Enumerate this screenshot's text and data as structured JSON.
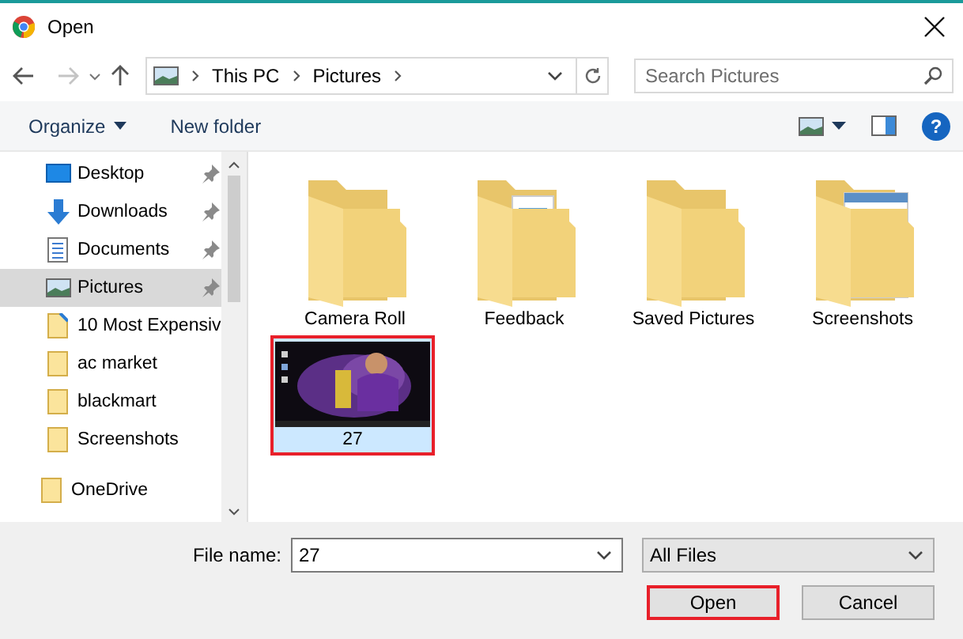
{
  "window": {
    "title": "Open"
  },
  "nav": {
    "breadcrumbs": [
      "This PC",
      "Pictures"
    ],
    "search": {
      "placeholder": "Search Pictures"
    }
  },
  "toolbar": {
    "organize": "Organize",
    "new_folder": "New folder",
    "help": "?"
  },
  "sidebar": {
    "items": [
      {
        "label": "Desktop",
        "kind": "desktop",
        "pinned": true,
        "selected": false
      },
      {
        "label": "Downloads",
        "kind": "downloads",
        "pinned": true,
        "selected": false
      },
      {
        "label": "Documents",
        "kind": "documents",
        "pinned": true,
        "selected": false
      },
      {
        "label": "Pictures",
        "kind": "pictures",
        "pinned": true,
        "selected": true
      },
      {
        "label": "10 Most Expensiv",
        "kind": "file",
        "pinned": false,
        "selected": false
      },
      {
        "label": "ac market",
        "kind": "folder",
        "pinned": false,
        "selected": false
      },
      {
        "label": "blackmart",
        "kind": "folder",
        "pinned": false,
        "selected": false
      },
      {
        "label": "Screenshots",
        "kind": "folder",
        "pinned": false,
        "selected": false
      },
      {
        "label": "OneDrive",
        "kind": "root",
        "pinned": false,
        "selected": false
      }
    ]
  },
  "files": [
    {
      "name": "Camera Roll",
      "kind": "folder",
      "selected": false,
      "highlighted": false
    },
    {
      "name": "Feedback",
      "kind": "folder-docs",
      "selected": false,
      "highlighted": false
    },
    {
      "name": "Saved Pictures",
      "kind": "folder",
      "selected": false,
      "highlighted": false
    },
    {
      "name": "Screenshots",
      "kind": "folder-screens",
      "selected": false,
      "highlighted": false
    },
    {
      "name": "27",
      "kind": "picture",
      "selected": true,
      "highlighted": true
    }
  ],
  "footer": {
    "file_name_label": "File name:",
    "file_name": "27",
    "filter": "All Files",
    "buttons": [
      {
        "label": "Open",
        "highlighted": true
      },
      {
        "label": "Cancel",
        "highlighted": false
      }
    ]
  }
}
